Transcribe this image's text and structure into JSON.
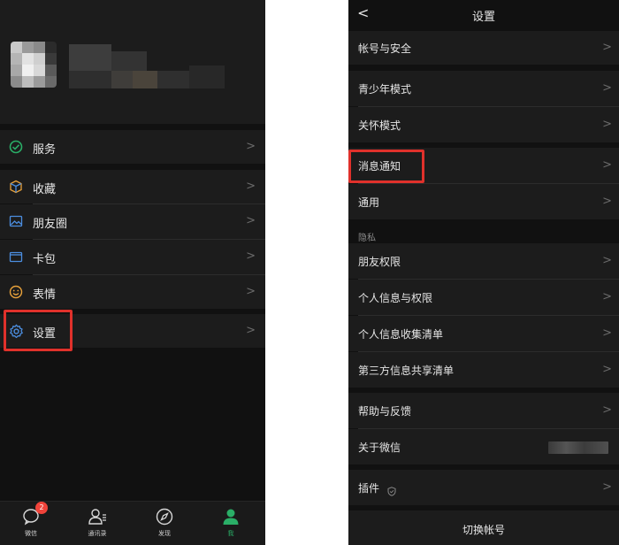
{
  "left_screen": {
    "menu": {
      "services": "服务",
      "favorites": "收藏",
      "moments": "朋友圈",
      "cards": "卡包",
      "stickers": "表情",
      "settings": "设置"
    },
    "chevron": ">",
    "tabbar": {
      "chats": "微信",
      "chats_badge": "2",
      "contacts": "通讯录",
      "discover": "发现",
      "me": "我"
    },
    "highlight_color": "#e0312b",
    "active_tab_color": "#2aae67"
  },
  "right_screen": {
    "back_glyph": "<",
    "title": "设置",
    "items": {
      "account_security": "帐号与安全",
      "teen_mode": "青少年模式",
      "care_mode": "关怀模式",
      "notifications": "消息通知",
      "general": "通用",
      "privacy_section": "隐私",
      "friend_permissions": "朋友权限",
      "personal_info_permissions": "个人信息与权限",
      "personal_info_list": "个人信息收集清单",
      "third_party_list": "第三方信息共享清单",
      "help_feedback": "帮助与反馈",
      "about": "关于微信",
      "plugins": "插件",
      "switch_account": "切换帐号"
    },
    "chevron": ">"
  },
  "icons": {
    "services": "services-check-icon",
    "favorites": "cube-icon",
    "moments": "picture-icon",
    "cards": "wallet-icon",
    "stickers": "smiley-icon",
    "settings": "gear-icon",
    "plugins": "shield-icon"
  }
}
